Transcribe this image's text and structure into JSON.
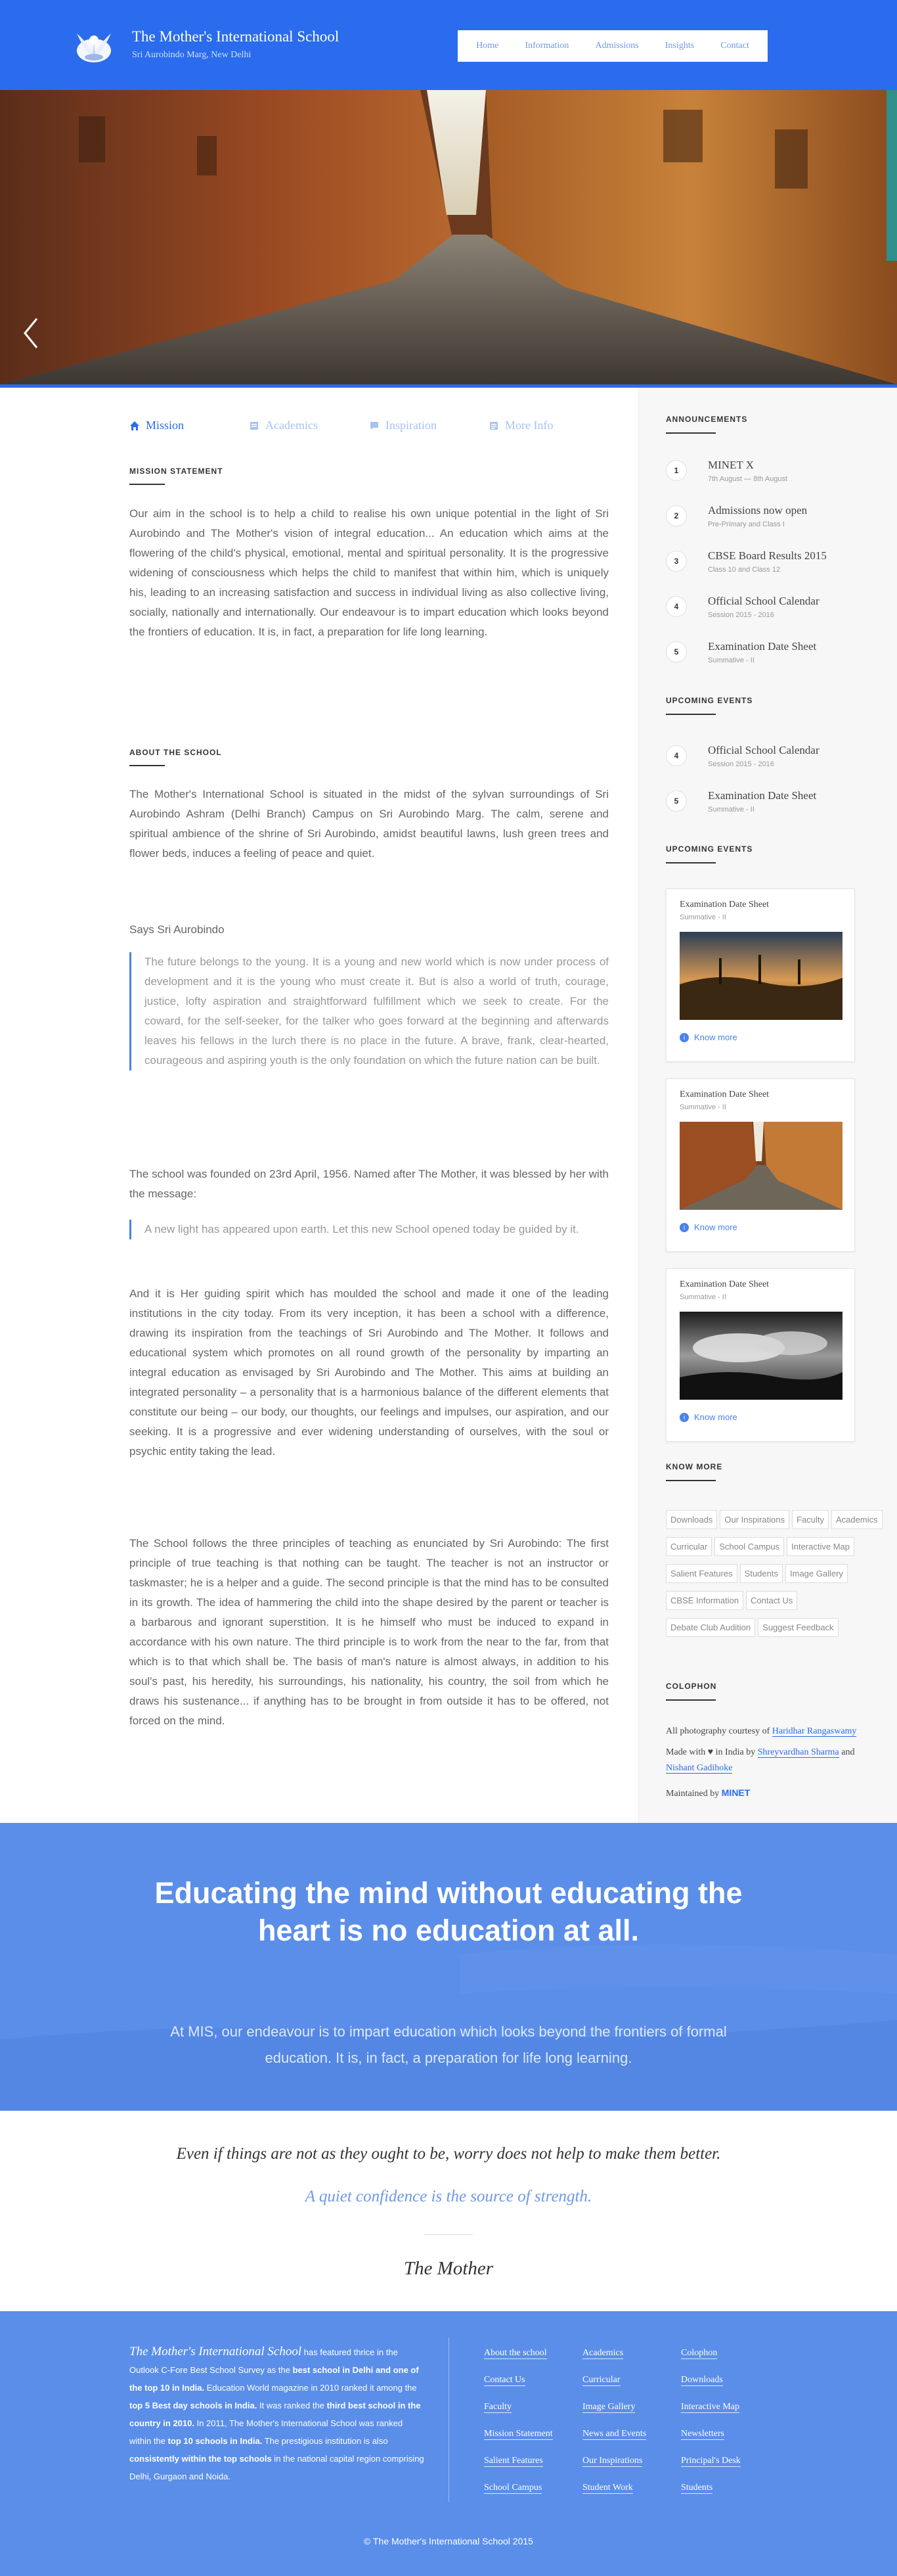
{
  "header": {
    "title": "The Mother's International School",
    "subtitle": "Sri Aurobindo Marg, New Delhi",
    "nav": [
      "Home",
      "Information",
      "Admissions",
      "Insights",
      "Contact"
    ]
  },
  "tabs": [
    "Mission",
    "Academics",
    "Inspiration",
    "More Info"
  ],
  "mission": {
    "heading": "MISSION STATEMENT",
    "text": "Our aim in the school is to help a child to realise his own unique potential in the light of Sri Aurobindo and The Mother's vision of integral education... An education which aims at the flowering of the child's physical, emotional, mental and spiritual personality. It is the progressive widening of consciousness which helps the child to manifest that within him, which is uniquely his, leading to an increasing satisfaction and success in individual living as also collective living, socially, nationally and internationally. Our endeavour is to impart education which looks beyond the frontiers of education. It is, in fact, a preparation for life long learning."
  },
  "about": {
    "heading": "ABOUT THE SCHOOL",
    "p1": "The Mother's International School is situated in the midst of the sylvan surroundings of Sri Aurobindo Ashram (Delhi Branch) Campus on Sri Aurobindo Marg. The calm, serene and spiritual ambience of the shrine of Sri Aurobindo, amidst beautiful lawns, lush green trees and flower beds, induces a feeling of peace and quiet.",
    "says": "Says Sri Aurobindo",
    "quote1": "The future belongs to the young. It is a young and new world which is now under process of development and it is the young who must create it. But is also a world of truth, courage, justice, lofty aspiration and straightforward fulfillment which we seek to create. For the coward, for the self-seeker, for the talker who goes forward at the beginning and afterwards leaves his fellows in the lurch there is no place in the future. A brave, frank, clear-hearted, courageous and aspiring youth is the only foundation on which the future nation can be built.",
    "p2": "The school was founded on 23rd April, 1956. Named after The Mother, it was blessed by her with the message:",
    "quote2": "A new light has appeared upon earth. Let this new School opened today be guided by it.",
    "p3": "And it is Her guiding spirit which has moulded the school and made it one of the leading institutions in the city today. From its very inception, it has been a school with a difference, drawing its inspiration from the teachings of Sri Aurobindo and The Mother. It follows and educational system which promotes on all round growth of the personality by imparting an integral education as envisaged by Sri Aurobindo and The Mother. This aims at building an integrated personality – a personality that is a harmonious balance of the different elements that constitute our being – our body, our thoughts, our feelings and impulses, our aspiration, and our seeking. It is a progressive and ever widening understanding of ourselves, with the soul or psychic entity taking the lead.",
    "p4": "The School follows the three principles of teaching as enunciated by Sri Aurobindo: The first principle of true teaching is that nothing can be taught. The teacher is not an instructor or taskmaster; he is a helper and a guide. The second principle is that the mind has to be consulted in its growth. The idea of hammering the child into the shape desired by the parent or teacher is a barbarous and ignorant superstition. It is he himself who must be induced to expand in accordance with his own nature. The third principle is to work from the near to the far, from that which is to that which shall be. The basis of man's nature is almost always, in addition to his soul's past, his heredity, his surroundings, his nationality, his country, the soil from which he draws his sustenance... if anything has to be brought in from outside it has to be offered, not forced on the mind."
  },
  "sidebar": {
    "announcements_title": "ANNOUNCEMENTS",
    "announcements": [
      {
        "num": "1",
        "title": "MINET X",
        "sub": "7th August — 8th August"
      },
      {
        "num": "2",
        "title": "Admissions now open",
        "sub": "Pre-Primary and Class I"
      },
      {
        "num": "3",
        "title": "CBSE Board Results 2015",
        "sub": "Class 10 and Class 12"
      },
      {
        "num": "4",
        "title": "Official School Calendar",
        "sub": "Session 2015 - 2016"
      },
      {
        "num": "5",
        "title": "Examination Date Sheet",
        "sub": "Summative - II"
      }
    ],
    "upcoming_title": "UPCOMING EVENTS",
    "upcoming": [
      {
        "num": "4",
        "title": "Official School Calendar",
        "sub": "Session 2015 - 2016"
      },
      {
        "num": "5",
        "title": "Examination Date Sheet",
        "sub": "Summative - II"
      }
    ],
    "events_title": "UPCOMING EVENTS",
    "events": [
      {
        "title": "Examination Date Sheet",
        "sub": "Summative - II",
        "more": "Know more"
      },
      {
        "title": "Examination Date Sheet",
        "sub": "Summative - II",
        "more": "Know more"
      },
      {
        "title": "Examination Date Sheet",
        "sub": "Summative - II",
        "more": "Know more"
      }
    ],
    "know_more_title": "KNOW MORE",
    "tags": [
      "Downloads",
      "Our Inspirations",
      "Faculty",
      "Academics",
      "Curricular",
      "School Campus",
      "Interactive Map",
      "Salient Features",
      "Students",
      "Image Gallery",
      "CBSE Information",
      "Contact Us",
      "Debate Club Audition",
      "Suggest Feedback"
    ],
    "colophon_title": "COLOPHON",
    "colophon": {
      "photo_prefix": "All photography courtesy of",
      "photographer": "Haridhar Rangaswamy",
      "made_prefix": "Made with ♥ in India by",
      "maker1": "Shreyvardhan Sharma",
      "and": "and",
      "maker2": "Nishant Gadihoke",
      "maintained_prefix": "Maintained by",
      "maintainer": "MINET"
    }
  },
  "banner": {
    "heading": "Educating the mind without educating the heart is no education at all.",
    "text": "At MIS, our endeavour is to impart education which looks beyond the frontiers of formal education. It is, in fact, a preparation for life long learning."
  },
  "quotes": {
    "line1": "Even if things are not as they ought to be, worry does not help to make them better.",
    "line2": "A quiet confidence is the source of strength.",
    "author": "The Mother"
  },
  "footer": {
    "brand": "The Mother's International School",
    "t1": " has featured thrice in the Outlook C-Fore Best School Survey as the ",
    "b1": "best school in Delhi and one of the top 10 in India.",
    "t2": " Education World magazine in 2010 ranked it among the ",
    "b2": "top 5 Best day schools in India.",
    "t3": " It was ranked the ",
    "b3": "third best school in the country in 2010.",
    "t4": " In 2011, The Mother's International School was ranked within the ",
    "b4": "top 10 schools in India.",
    "t5": " The prestigious institution is also ",
    "b5": "consistently within the top schools",
    "t6": " in the national capital region comprising Delhi, Gurgaon and Noida.",
    "links": [
      [
        "About the school",
        "Academics",
        "Colophon"
      ],
      [
        "Contact Us",
        "Curricular",
        "Downloads"
      ],
      [
        "Faculty",
        "Image Gallery",
        "Interactive Map"
      ],
      [
        "Mission Statement",
        "News and Events",
        "Newsletters"
      ],
      [
        "Salient Features",
        "Our Inspirations",
        "Principal's Desk"
      ],
      [
        "School Campus",
        "Student Work",
        "Students"
      ]
    ],
    "copyright": "© The Mother's International School 2015"
  }
}
